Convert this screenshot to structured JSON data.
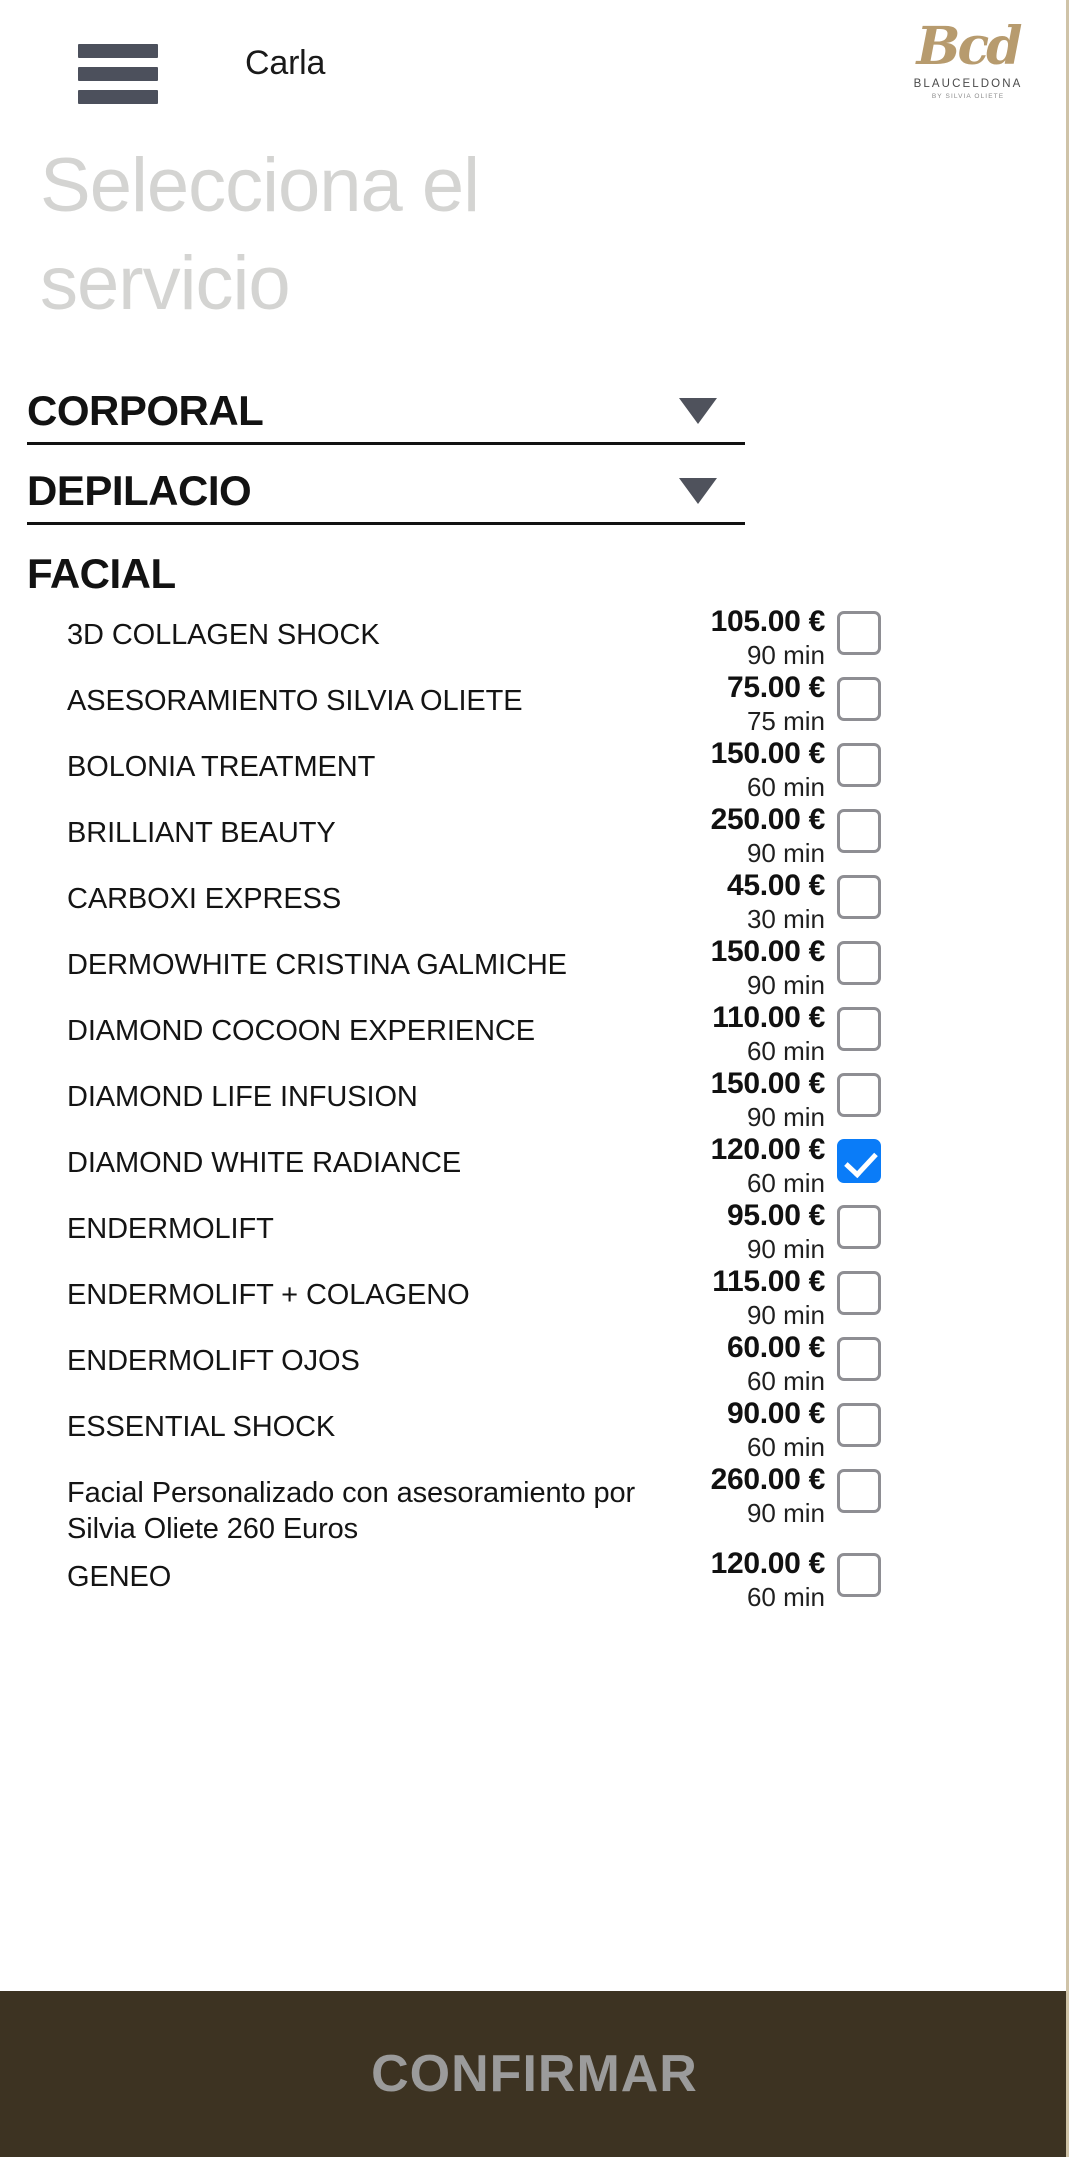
{
  "header": {
    "menu_icon": "hamburger-menu-icon",
    "user_name": "Carla",
    "brand_mark": "Bcd",
    "brand_name": "BLAUCELDONA",
    "brand_sub": "BY SILVIA OLIETE"
  },
  "page_title": "Selecciona el servicio",
  "accordions": [
    {
      "label": "CORPORAL",
      "caret": "chevron-down-icon",
      "expanded": false
    },
    {
      "label": "DEPILACIO",
      "caret": "chevron-down-icon",
      "expanded": false
    }
  ],
  "facial": {
    "label": "FACIAL",
    "expanded": true,
    "services": [
      {
        "name": "3D COLLAGEN SHOCK",
        "price": "105.00 €",
        "duration": "90 min",
        "checked": false
      },
      {
        "name": "ASESORAMIENTO SILVIA OLIETE",
        "price": "75.00 €",
        "duration": "75 min",
        "checked": false
      },
      {
        "name": "BOLONIA TREATMENT",
        "price": "150.00 €",
        "duration": "60 min",
        "checked": false
      },
      {
        "name": "BRILLIANT BEAUTY",
        "price": "250.00 €",
        "duration": "90 min",
        "checked": false
      },
      {
        "name": "CARBOXI EXPRESS",
        "price": "45.00 €",
        "duration": "30 min",
        "checked": false
      },
      {
        "name": "DERMOWHITE CRISTINA GALMICHE",
        "price": "150.00 €",
        "duration": "90 min",
        "checked": false
      },
      {
        "name": "DIAMOND COCOON EXPERIENCE",
        "price": "110.00 €",
        "duration": "60 min",
        "checked": false
      },
      {
        "name": "DIAMOND LIFE INFUSION",
        "price": "150.00 €",
        "duration": "90 min",
        "checked": false
      },
      {
        "name": "DIAMOND WHITE RADIANCE",
        "price": "120.00 €",
        "duration": "60 min",
        "checked": true
      },
      {
        "name": "ENDERMOLIFT",
        "price": "95.00 €",
        "duration": "90 min",
        "checked": false
      },
      {
        "name": "ENDERMOLIFT + COLAGENO",
        "price": "115.00 €",
        "duration": "90 min",
        "checked": false
      },
      {
        "name": "ENDERMOLIFT OJOS",
        "price": "60.00 €",
        "duration": "60 min",
        "checked": false
      },
      {
        "name": "ESSENTIAL SHOCK",
        "price": "90.00 €",
        "duration": "60 min",
        "checked": false
      },
      {
        "name": "Facial Personalizado con asesoramiento por Silvia Oliete 260 Euros",
        "price": "260.00 €",
        "duration": "90 min",
        "checked": false
      },
      {
        "name": "GENEO",
        "price": "120.00 €",
        "duration": "60 min",
        "checked": false
      }
    ]
  },
  "footer": {
    "confirm_label": "CONFIRMAR"
  },
  "colors": {
    "brand_gold": "#b79b6e",
    "footer_bg": "#3d3322",
    "footer_text": "#9b9b9b",
    "checkbox_checked": "#0a7cf8",
    "title_gray": "#d4d4d2",
    "hamburger": "#4c505c",
    "page_border": "#cfc3a8"
  }
}
